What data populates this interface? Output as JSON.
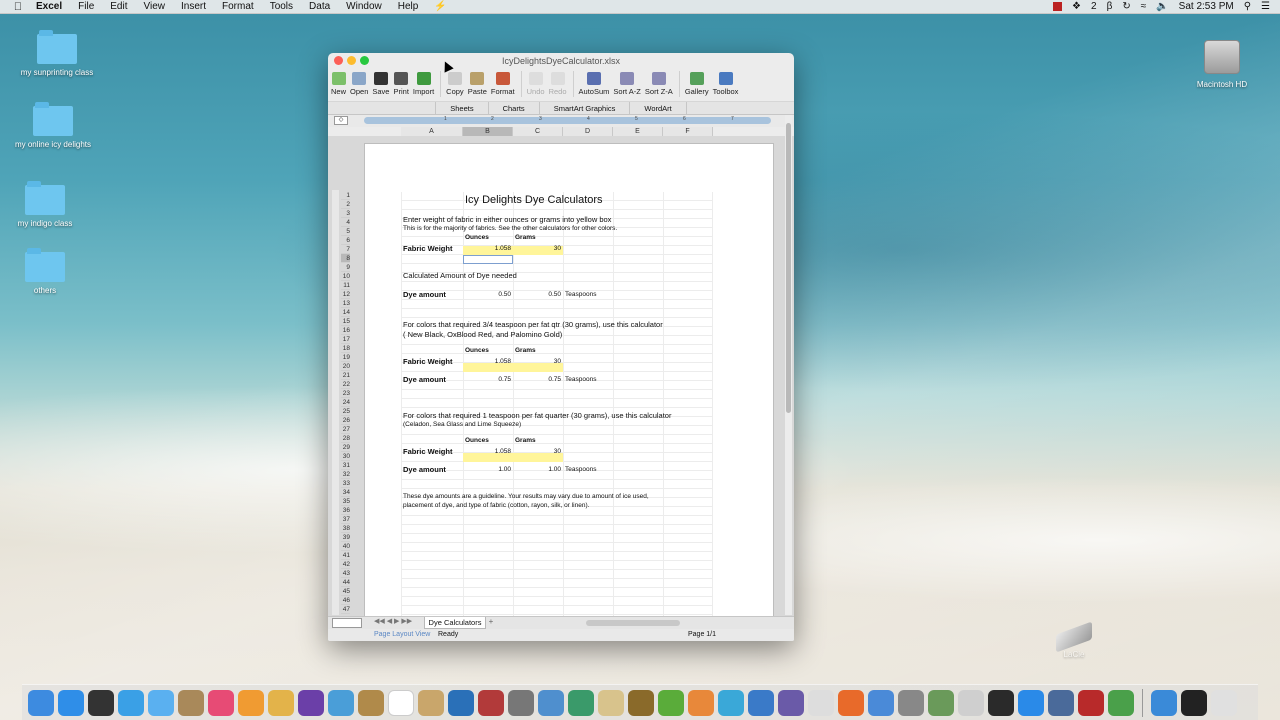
{
  "menubar": {
    "app_name": "Excel",
    "items": [
      "File",
      "Edit",
      "View",
      "Insert",
      "Format",
      "Tools",
      "Data",
      "Window",
      "Help"
    ],
    "status_number": "2",
    "clock": "Sat 2:53 PM"
  },
  "desktop": {
    "icons": [
      {
        "label": "my sunprinting class"
      },
      {
        "label": "my online icy delights"
      },
      {
        "label": "my indigo class"
      },
      {
        "label": "others"
      }
    ],
    "drive_label": "Macintosh HD",
    "external_drive_label": "LaCie"
  },
  "window": {
    "title": "IcyDelightsDyeCalculator.xlsx",
    "toolbar": [
      "New",
      "Open",
      "Save",
      "Print",
      "Import",
      "Copy",
      "Paste",
      "Format",
      "Undo",
      "Redo",
      "AutoSum",
      "Sort A-Z",
      "Sort Z-A",
      "Gallery",
      "Toolbox"
    ],
    "ribbon_tabs": [
      "Sheets",
      "Charts",
      "SmartArt Graphics",
      "WordArt"
    ],
    "ruler_numbers": [
      "1",
      "2",
      "3",
      "4",
      "5",
      "6",
      "7"
    ],
    "columns": [
      "A",
      "B",
      "C",
      "D",
      "E",
      "F"
    ],
    "selected_column": "B",
    "selected_row": "8",
    "rows": [
      "1",
      "2",
      "3",
      "4",
      "5",
      "6",
      "7",
      "8",
      "9",
      "10",
      "11",
      "12",
      "13",
      "14",
      "15",
      "16",
      "17",
      "18",
      "19",
      "20",
      "21",
      "22",
      "23",
      "24",
      "25",
      "26",
      "27",
      "28",
      "29",
      "30",
      "31",
      "32",
      "33",
      "34",
      "35",
      "36",
      "37",
      "38",
      "39",
      "40",
      "41",
      "42",
      "43",
      "44",
      "45",
      "46",
      "47"
    ],
    "sheet": {
      "title": "Icy Delights Dye Calculators",
      "intro1": "Enter weight of fabric in either ounces or grams into yellow box",
      "intro2": "This is for the majority of fabrics. See the other calculators for other colors.",
      "ounces_label": "Ounces",
      "grams_label": "Grams",
      "fabric_weight_label": "Fabric Weight",
      "dye_amount_label": "Dye amount",
      "calc1": {
        "ounces": "1.058",
        "grams": "30",
        "dye_oz": "0.50",
        "dye_g": "0.50",
        "unit": "Teaspoons"
      },
      "calculated_label": "Calculated Amount of Dye needed",
      "section2_line1": "For colors that required 3/4 teaspoon per fat qtr (30 grams), use this calculator",
      "section2_line2": "( New Black, OxBlood Red, and Palomino Gold)",
      "calc2": {
        "ounces": "1.058",
        "grams": "30",
        "dye_oz": "0.75",
        "dye_g": "0.75",
        "unit": "Teaspoons"
      },
      "section3_line1": "For colors that required 1 teaspoon per fat quarter (30 grams), use this calculator",
      "section3_line2": " (Celadon, Sea Glass and Lime Squeeze)",
      "calc3": {
        "ounces": "1.058",
        "grams": "30",
        "dye_oz": "1.00",
        "dye_g": "1.00",
        "unit": "Teaspoons"
      },
      "note1": "These dye amounts are a guideline. Your results may vary due to amount of ice used,",
      "note2": "placement of dye, and type of fabric (cotton, rayon, silk, or linen)."
    },
    "sheet_tab": "Dye Calculators",
    "status": {
      "view": "Page Layout View",
      "ready": "Ready",
      "page": "Page 1/1"
    }
  },
  "colors": {
    "yellow_input": "#fff59a",
    "selected_header": "#b8b8b8",
    "ruler_blue": "#a8c3dd"
  }
}
